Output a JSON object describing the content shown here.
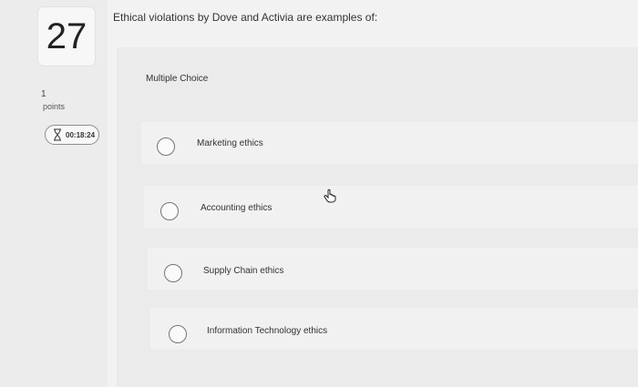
{
  "question": {
    "number": "27",
    "text": "Ethical violations by Dove and Activia are examples of:",
    "points_value": "1",
    "points_label": "points",
    "timer": "00:18:24",
    "type_label": "Multiple Choice"
  },
  "choices": [
    {
      "label": "Marketing ethics"
    },
    {
      "label": "Accounting ethics"
    },
    {
      "label": "Supply Chain ethics"
    },
    {
      "label": "Information Technology ethics"
    }
  ],
  "icons": {
    "timer": "hourglass-icon",
    "cursor": "hand-pointer-icon"
  }
}
